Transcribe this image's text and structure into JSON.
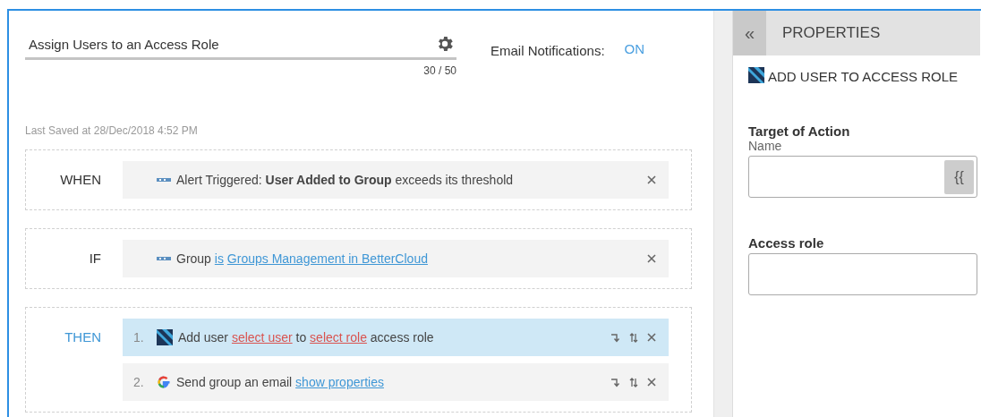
{
  "workflow": {
    "title": "Assign Users to an Access Role",
    "char_count": "30 / 50",
    "email_label": "Email Notifications:",
    "email_status": "ON",
    "last_saved": "Last Saved at 28/Dec/2018 4:52 PM"
  },
  "sections": [
    {
      "label": "WHEN",
      "active": false,
      "rows": [
        {
          "kind": "app",
          "selected": false,
          "reorderable": false,
          "parts": [
            {
              "kind": "plain",
              "text": "Alert Triggered: **User Added to Group** exceeds its threshold"
            }
          ]
        }
      ]
    },
    {
      "label": "IF",
      "active": false,
      "rows": [
        {
          "kind": "app",
          "selected": false,
          "reorderable": false,
          "parts": [
            {
              "kind": "plain",
              "text": "Group"
            },
            {
              "kind": "link",
              "text": "is"
            },
            {
              "kind": "link",
              "text": "Groups Management in BetterCloud"
            }
          ]
        }
      ]
    },
    {
      "label": "THEN",
      "active": true,
      "rows": [
        {
          "number": "1.",
          "kind": "role",
          "selected": true,
          "reorderable": true,
          "parts": [
            {
              "kind": "plain",
              "text": "Add user"
            },
            {
              "kind": "missing",
              "text": "select user"
            },
            {
              "kind": "plain",
              "text": "to"
            },
            {
              "kind": "missing",
              "text": "select role"
            },
            {
              "kind": "plain",
              "text": "access role"
            }
          ]
        },
        {
          "number": "2.",
          "kind": "google",
          "selected": false,
          "reorderable": true,
          "parts": [
            {
              "kind": "plain",
              "text": "Send group an email"
            },
            {
              "kind": "link",
              "text": "show properties"
            }
          ]
        }
      ]
    }
  ],
  "panel": {
    "collapse": "«",
    "title": "PROPERTIES",
    "action_title": "ADD USER TO ACCESS ROLE",
    "fields": [
      {
        "heading": "Target of Action",
        "label": "Name",
        "insert_button": "{{"
      },
      {
        "heading": "Access role"
      }
    ]
  }
}
